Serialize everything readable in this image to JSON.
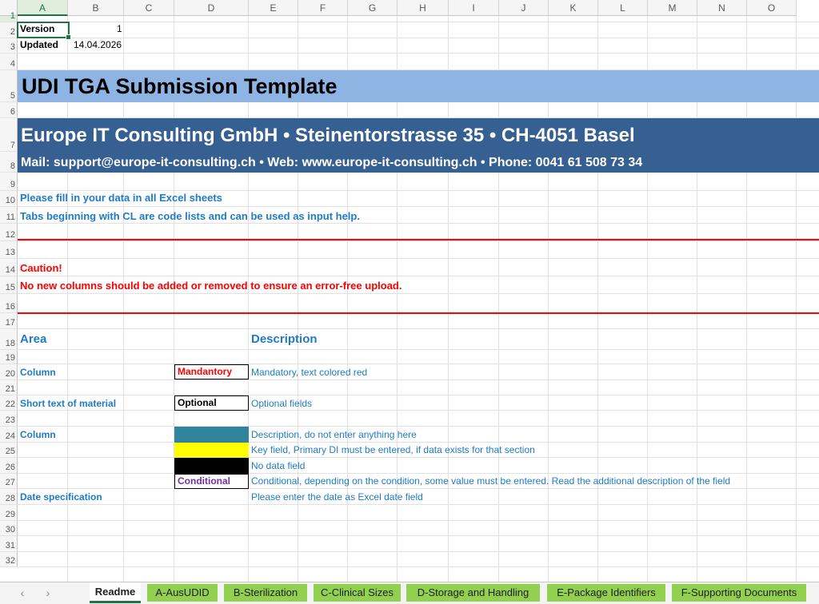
{
  "spreadsheet": {
    "columns": [
      "A",
      "B",
      "C",
      "D",
      "E",
      "F",
      "G",
      "H",
      "I",
      "J",
      "K",
      "L",
      "M",
      "N",
      "O"
    ],
    "rows": [
      "1",
      "2",
      "3",
      "4",
      "5",
      "6",
      "7",
      "8",
      "9",
      "10",
      "11",
      "12",
      "13",
      "14",
      "15",
      "16",
      "17",
      "18",
      "19",
      "20",
      "21",
      "22",
      "23",
      "24",
      "25",
      "26",
      "27",
      "28",
      "29",
      "30",
      "31",
      "32"
    ],
    "selected_cell": "A1",
    "cells": {
      "version_label": "Version",
      "version_value": "1",
      "updated_label": "Updated",
      "updated_value": "14.04.2026",
      "title": "UDI TGA Submission Template",
      "company_line": "Europe IT Consulting GmbH • Steinentorstrasse 35 • CH-4051 Basel",
      "contact_line": "Mail: support@europe-it-consulting.ch  • Web: www.europe-it-consulting.ch • Phone: 0041 61 508 73 34",
      "instruction_1": "Please fill in your data in all Excel sheets",
      "instruction_2": "Tabs beginning with CL are code lists and can be used as input help.",
      "caution_title": "Caution!",
      "caution_text": "No new columns should be added or removed to ensure an error-free upload.",
      "area_header": "Area",
      "description_header": "Description",
      "legend": [
        {
          "area": "Column",
          "sample": "Mandantory",
          "description": "Mandatory, text colored red"
        },
        {
          "area": "Short text of material",
          "sample": "Optional",
          "description": "Optional fields"
        },
        {
          "area": "Column",
          "sample": "",
          "description": "Description, do not enter anything here"
        },
        {
          "area": "",
          "sample": "",
          "description": "Key field, Primary DI must be entered, if data exists for that section"
        },
        {
          "area": "",
          "sample": "",
          "description": "No data field"
        },
        {
          "area": "",
          "sample": "Conditional",
          "description": "Conditional, depending on the condition, some value must be entered. Read the additional description of the field"
        },
        {
          "area": "Date specification",
          "sample": "",
          "description": "Please enter the date as Excel date field"
        }
      ]
    }
  },
  "colors": {
    "title_band": "#8db4e2",
    "company_band": "#366092",
    "blue_text": "#1f7bc8",
    "red_text": "#ff0000",
    "swatch_description": "#31849b",
    "swatch_key": "#ffff00",
    "swatch_no_data": "#000000",
    "conditional_text": "#7030a0",
    "tab_green": "#92d050",
    "excel_green": "#217346"
  },
  "sheet_tabs": {
    "prev_icon": "‹",
    "next_icon": "›",
    "tabs": [
      "Readme",
      "A-AusUDID",
      "B-Sterilization",
      "C-Clinical Sizes",
      "D-Storage and Handling",
      "E-Package Identifiers",
      "F-Supporting Documents"
    ],
    "active": "Readme"
  }
}
